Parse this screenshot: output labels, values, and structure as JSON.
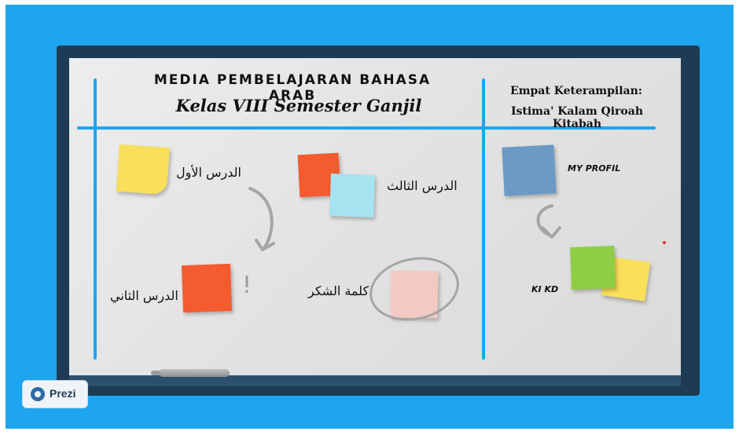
{
  "header": {
    "title_line1": "MEDIA PEMBELAJARAN BAHASA ARAB",
    "title_line2": "Kelas VIII  Semester Ganjil"
  },
  "right_header": {
    "line1": "Empat Keterampilan:",
    "line2": "Istima' Kalam Qiroah Kitabah"
  },
  "lessons": {
    "lesson1": "الدرس الأول",
    "lesson2": "الدرس الثاني",
    "lesson3": "الدرس الثالث",
    "thanks": "كلمة الشكر",
    "exclamation": "!"
  },
  "right_items": {
    "profile": "MY PROFIL",
    "kikd": "KI KD"
  },
  "app": {
    "brand": "Prezi"
  },
  "colors": {
    "background": "#1ea5ef",
    "frame": "#1f3a54",
    "yellow_note": "#f9df5a",
    "orange_note": "#f45b2f",
    "cyan_note": "#a6e3f1",
    "pink_note": "#f3c9c4",
    "blue_note": "#6b9ac4",
    "green_note": "#8fcd45"
  }
}
